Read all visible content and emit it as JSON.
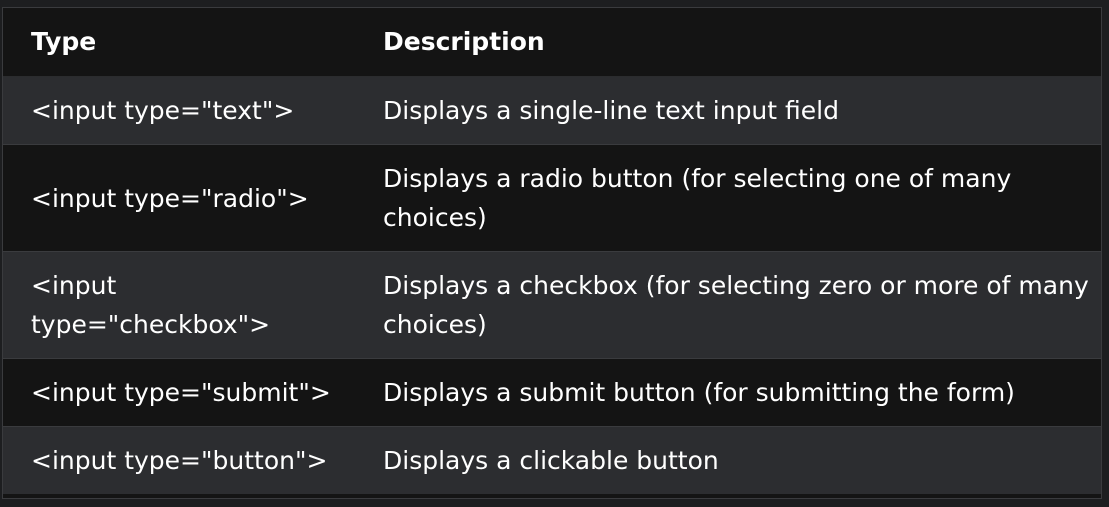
{
  "table": {
    "headers": [
      "Type",
      "Description"
    ],
    "rows": [
      {
        "type": "<input type=\"text\">",
        "description": "Displays a single-line text input field"
      },
      {
        "type": "<input type=\"radio\">",
        "description": "Displays a radio button (for selecting one of many choices)"
      },
      {
        "type": "<input type=\"checkbox\">",
        "description": "Displays a checkbox (for selecting zero or more of many choices)"
      },
      {
        "type": "<input type=\"submit\">",
        "description": "Displays a submit button (for submitting the form)"
      },
      {
        "type": "<input type=\"button\">",
        "description": "Displays a clickable button"
      }
    ]
  },
  "colors": {
    "page_background": "#1d1e20",
    "header_background": "#141414",
    "row_odd_background": "#2c2d30",
    "row_even_background": "#141414",
    "text": "#ffffff"
  }
}
